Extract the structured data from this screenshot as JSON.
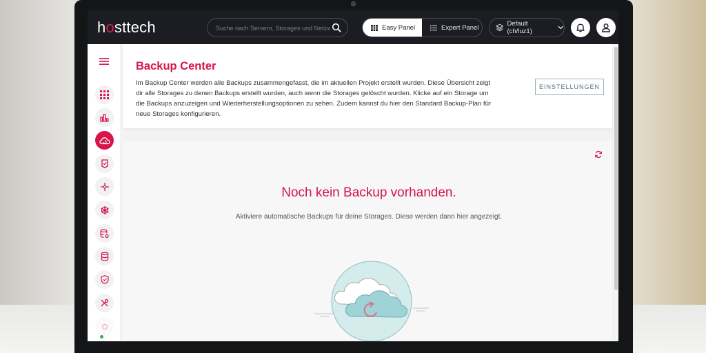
{
  "brand": {
    "logo_prefix": "h",
    "logo_o": "o",
    "logo_suffix": "sttech",
    "accent": "#d6154a"
  },
  "topbar": {
    "search_placeholder": "Suche nach Servern, Storages und Netzwerken",
    "easy_panel_label": "Easy Panel",
    "expert_panel_label": "Expert Panel",
    "project_label": "Default (ch/luz1)",
    "icons": [
      "search-icon",
      "grid-icon",
      "list-icon",
      "layers-icon",
      "chevron-down-icon",
      "bell-icon",
      "user-icon"
    ]
  },
  "sidebar": {
    "items": [
      {
        "icon": "dashboard-icon"
      },
      {
        "icon": "chart-icon"
      },
      {
        "icon": "cloud-backup-icon",
        "active": true
      },
      {
        "icon": "shield-doc-icon"
      },
      {
        "icon": "network-icon"
      },
      {
        "icon": "kubernetes-icon"
      },
      {
        "icon": "database-settings-icon"
      },
      {
        "icon": "database-icon"
      },
      {
        "icon": "security-icon"
      },
      {
        "icon": "tools-icon"
      }
    ]
  },
  "main": {
    "title": "Backup Center",
    "description": "Im Backup Center werden alle Backups zusammengefasst, die im aktuellen Projekt erstellt wurden. Diese Übersicht zeigt dir alle Storages zu denen Backups erstellt wurden, auch wenn die Storages gelöscht wurden. Klicke auf ein Storage um die Backups anzuzeigen und Wiederherstellungsoptionen zu sehen. Zudem kannst du hier den Standard Backup-Plan für neue Storages konfigurieren.",
    "settings_button": "EINSTELLUNGEN",
    "empty_title": "Noch kein Backup vorhanden.",
    "empty_subtitle": "Aktiviere automatische Backups für deine Storages. Diese werden dann hier angezeigt."
  }
}
